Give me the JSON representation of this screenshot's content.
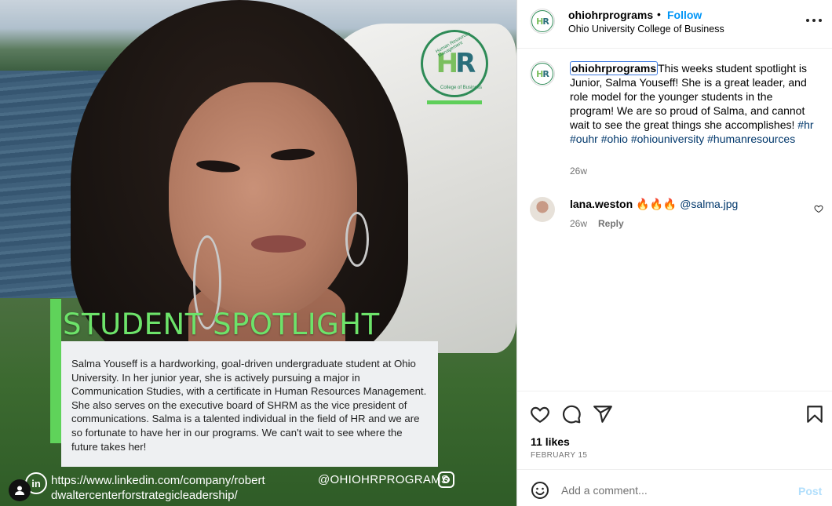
{
  "media": {
    "logo": {
      "letters_h": "H",
      "letters_r": "R",
      "ring_top": "Human Resources Management",
      "ring_bottom": "College of Business"
    },
    "title": "STUDENT SPOTLIGHT",
    "bio": "Salma Youseff is a hardworking, goal-driven undergraduate student at Ohio University. In her junior year, she is actively pursuing a major in Communication Studies, with a certificate in Human Resources Management. She also serves on the executive board of SHRM as the vice president of communications. Salma is a talented individual in the field of HR and we are so fortunate to have her in our programs. We can't wait to see where the future takes her!",
    "linkedin_icon": "in",
    "linkedin_url": "https://www.linkedin.com/company/robertdwaltercenterforstrategicleadership/",
    "ig_handle": "@OHIOHRPROGRAMS"
  },
  "header": {
    "username": "ohiohrprograms",
    "separator": "•",
    "follow_label": "Follow",
    "subtitle": "Ohio University College of Business",
    "avatar_h": "H",
    "avatar_r": "R"
  },
  "caption": {
    "username": "ohiohrprograms",
    "text": "This weeks student spotlight is Junior, Salma Youseff! She is a great leader, and role model for the younger students in the program! We are so proud of Salma, and cannot wait to see the great things she accomplishes! ",
    "hashtags": [
      "#hr",
      "#ouhr",
      "#ohio",
      "#ohiouniversity",
      "#humanresources"
    ],
    "time": "26w"
  },
  "comment": {
    "username": "lana.weston",
    "emoji": "🔥🔥🔥",
    "mention": "@salma.jpg",
    "time": "26w",
    "reply_label": "Reply"
  },
  "actions": {
    "likes": "11 likes",
    "date": "FEBRUARY 15"
  },
  "composer": {
    "placeholder": "Add a comment...",
    "post_label": "Post"
  },
  "colors": {
    "accent": "#0095f6",
    "spotlight_green": "#6de36a",
    "link": "#00376b"
  },
  "icons": [
    "linkedin-icon",
    "instagram-icon",
    "user-tag-icon",
    "more-icon",
    "heart-icon",
    "comment-icon",
    "share-icon",
    "bookmark-icon",
    "emoji-icon"
  ]
}
